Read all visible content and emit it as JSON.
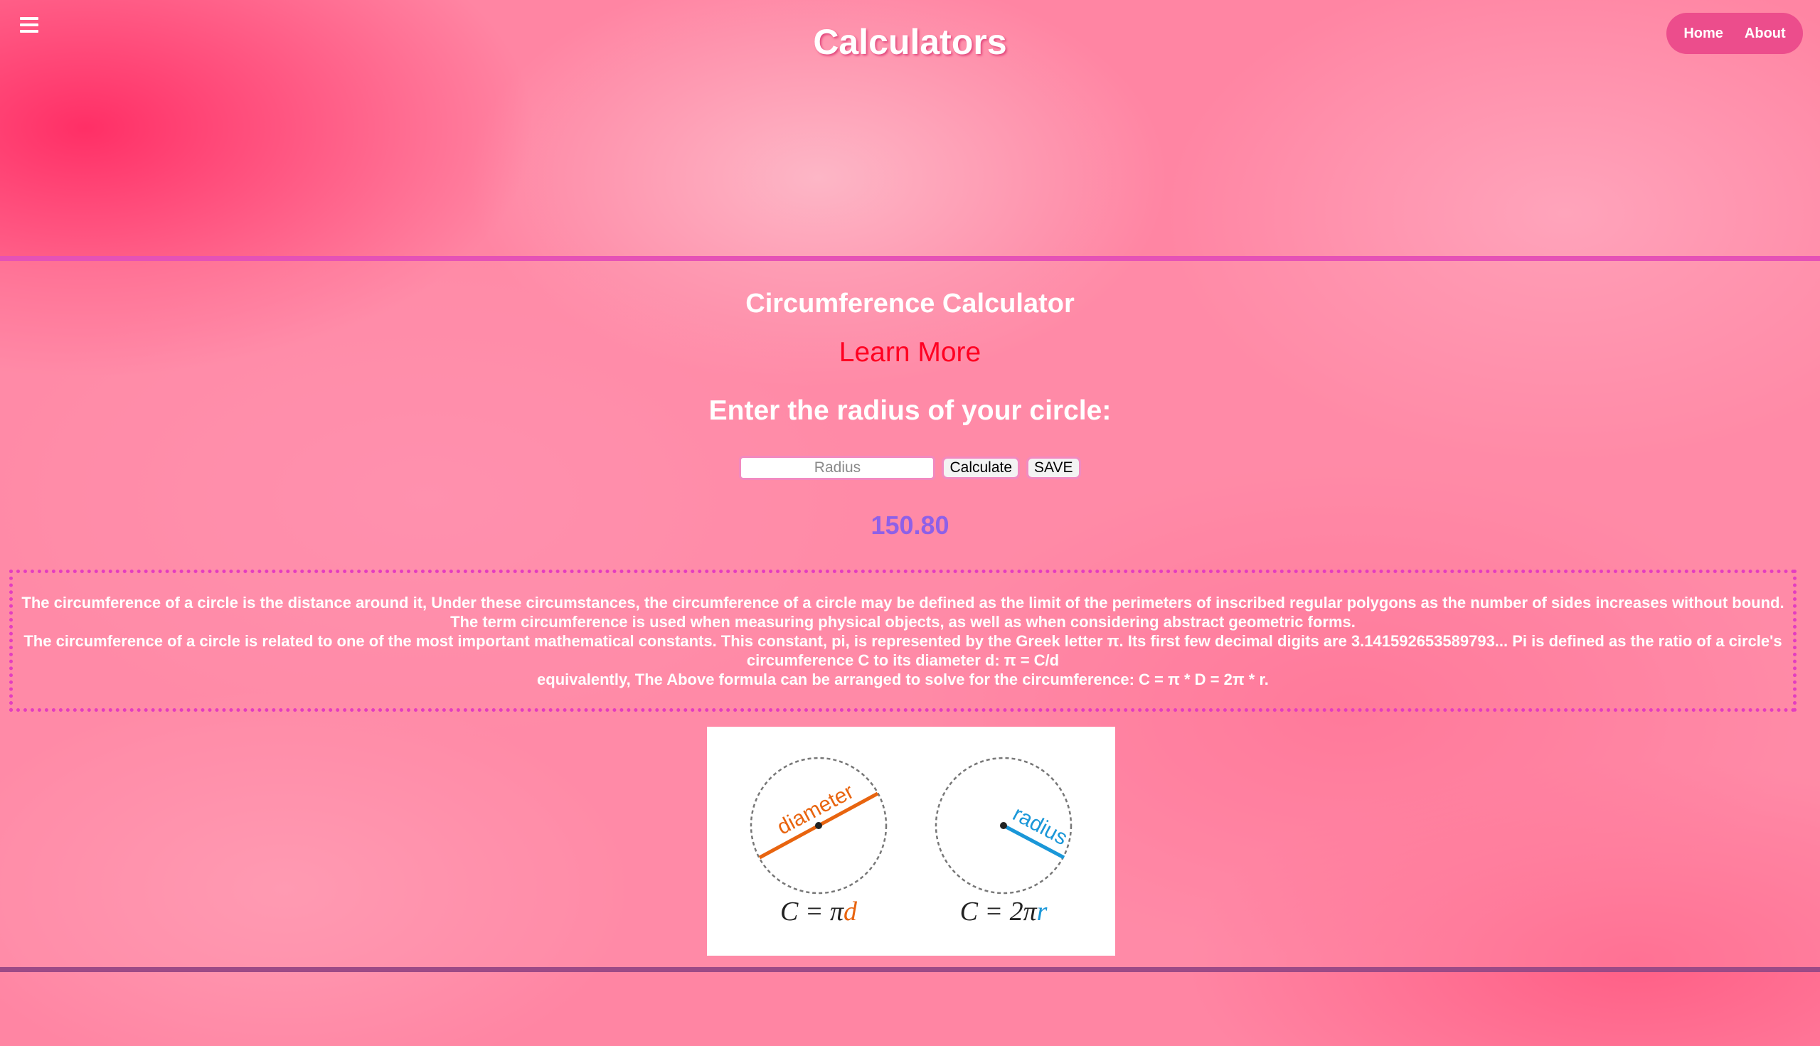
{
  "header": {
    "title": "Calculators",
    "nav": [
      {
        "label": "Home"
      },
      {
        "label": "About"
      }
    ]
  },
  "calculator": {
    "title": "Circumference Calculator",
    "learn_more": "Learn More",
    "prompt": "Enter the radius of your circle:",
    "input_placeholder": "Radius",
    "input_value": "",
    "calculate_label": "Calculate",
    "save_label": "SAVE",
    "result": "150.80"
  },
  "info": {
    "lines": [
      "The circumference of a circle is the distance around it, Under these circumstances, the circumference of a circle may be defined as the limit of the perimeters of inscribed regular polygons as the number of sides increases without bound. The term circumference is used when measuring physical objects, as well as when considering abstract geometric forms.",
      "The circumference of a circle is related to one of the most important mathematical constants. This constant, pi, is represented by the Greek letter π. Its first few decimal digits are 3.141592653589793... Pi is defined as the ratio of a circle's circumference C to its diameter d: π = C/d",
      "equivalently, The Above formula can be arranged to solve for the circumference: C = π * D = 2π * r."
    ]
  },
  "figure": {
    "left_label": "diameter",
    "right_label": "radius",
    "left_formula_prefix": "C = π",
    "left_formula_var": "d",
    "right_formula_prefix": "C = 2π",
    "right_formula_var": "r",
    "diameter_color": "#e8640f",
    "radius_color": "#1a97d8"
  },
  "colors": {
    "nav_pill": "#ec4d8c",
    "rule_top": "#e552b6",
    "rule_bottom": "#9c4a86",
    "learn_more": "#ff0022",
    "result": "#8e60e8",
    "info_border": "#e43dc0"
  }
}
